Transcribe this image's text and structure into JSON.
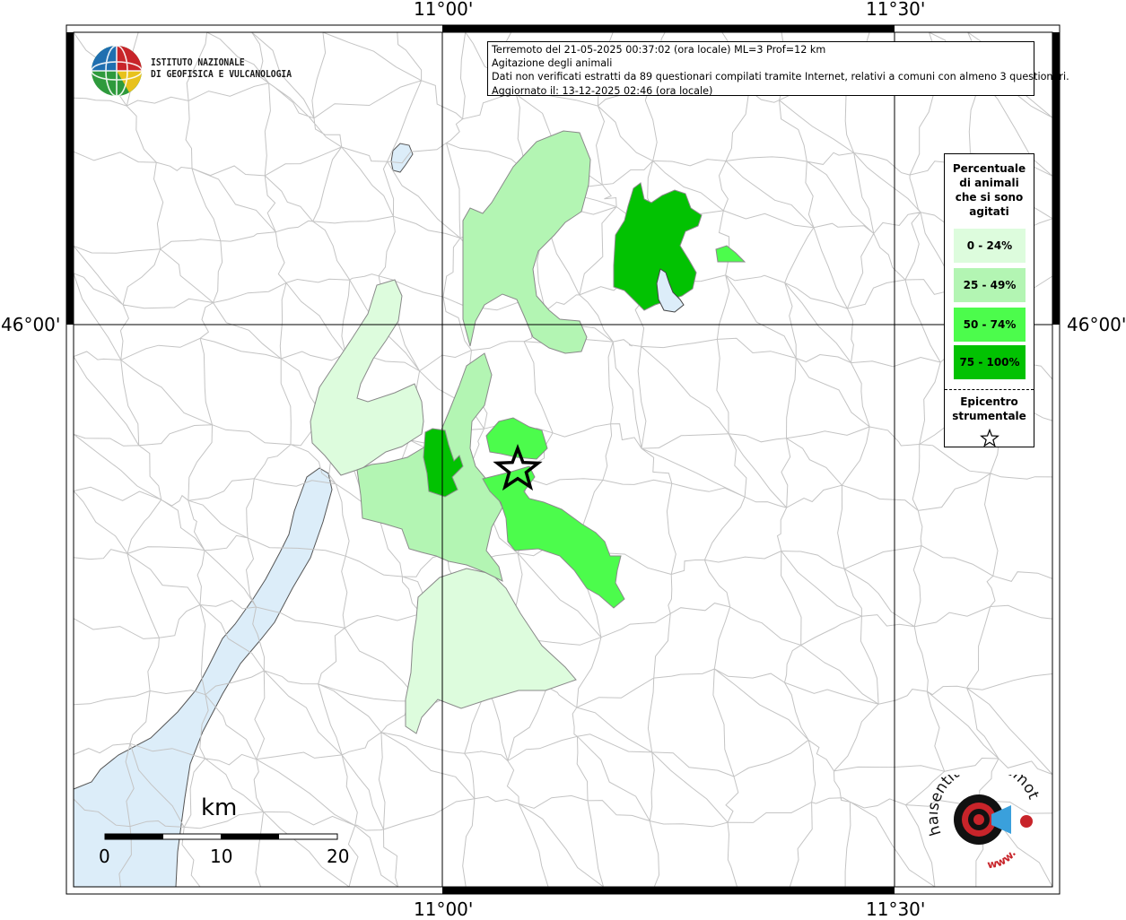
{
  "map": {
    "longitude_labels": [
      "11°00'",
      "11°30'"
    ],
    "latitude_labels": [
      "46°00'",
      "46°00'"
    ],
    "colors": {
      "water": "#dcedf9",
      "boundary": "#c8c8c8",
      "class_0_24": "#ddfcdd",
      "class_25_49": "#b3f5b3",
      "class_50_74": "#4cfc4c",
      "class_75_100": "#02c202"
    }
  },
  "info": {
    "line1": "Terremoto del 21-05-2025 00:37:02 (ora locale) ML=3 Prof=12 km",
    "line2": "Agitazione degli animali",
    "line3": "Dati non verificati estratti da 89 questionari compilati tramite Internet, relativi a comuni con almeno 3 questionari.",
    "line4": "Aggiornato il: 13-12-2025 02:46 (ora locale)"
  },
  "legend": {
    "title_lines": [
      "Percentuale",
      "di animali",
      "che si sono",
      "agitati"
    ],
    "classes": [
      {
        "label": "0 - 24%",
        "color": "#ddfcdd"
      },
      {
        "label": "25 - 49%",
        "color": "#b3f5b3"
      },
      {
        "label": "50 - 74%",
        "color": "#4cfc4c"
      },
      {
        "label": "75 - 100%",
        "color": "#02c202"
      }
    ],
    "epicenter_lines": [
      "Epicentro",
      "strumentale"
    ],
    "epicenter_icon": "star-outline-icon"
  },
  "logo": {
    "line1": "ISTITUTO NAZIONALE",
    "line2": "DI GEOFISICA E VULCANOLOGIA",
    "icon": "globe-icon"
  },
  "scale": {
    "unit": "km",
    "ticks": [
      "0",
      "10",
      "20"
    ]
  },
  "hsit_logo": {
    "text_main": "haisentitoilterremoto.it",
    "text_small": "www.",
    "icon": "target-megaphone-icon"
  }
}
